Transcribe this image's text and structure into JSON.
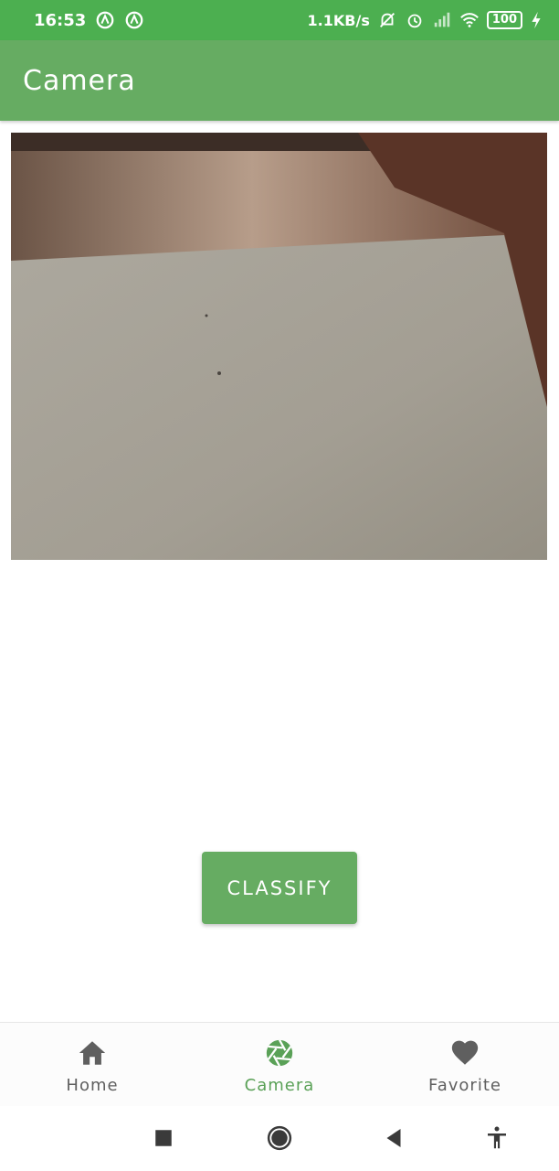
{
  "status_bar": {
    "time": "16:53",
    "network_speed": "1.1KB/s",
    "battery": "100",
    "icons": [
      "circle-a-icon",
      "circle-a-icon",
      "mute-bell-icon",
      "alarm-icon",
      "signal-icon",
      "wifi-icon",
      "battery-icon",
      "charging-bolt-icon"
    ]
  },
  "app_bar": {
    "title": "Camera"
  },
  "camera_image": {
    "icon": "camera-preview-photo"
  },
  "actions": {
    "classify_label": "CLASSIFY"
  },
  "bottom_nav": {
    "items": [
      {
        "label": "Home",
        "icon": "home-icon",
        "active": false
      },
      {
        "label": "Camera",
        "icon": "camera-shutter-icon",
        "active": true
      },
      {
        "label": "Favorite",
        "icon": "heart-icon",
        "active": false
      }
    ]
  },
  "system_nav": {
    "icons": [
      "recents-square-icon",
      "home-circle-icon",
      "back-triangle-icon",
      "accessibility-icon"
    ]
  },
  "colors": {
    "status_bar": "#4caf50",
    "app_bar": "#66ac62",
    "button": "#66ac62",
    "nav_active": "#5aa157",
    "nav_inactive": "#5f5f5f"
  }
}
